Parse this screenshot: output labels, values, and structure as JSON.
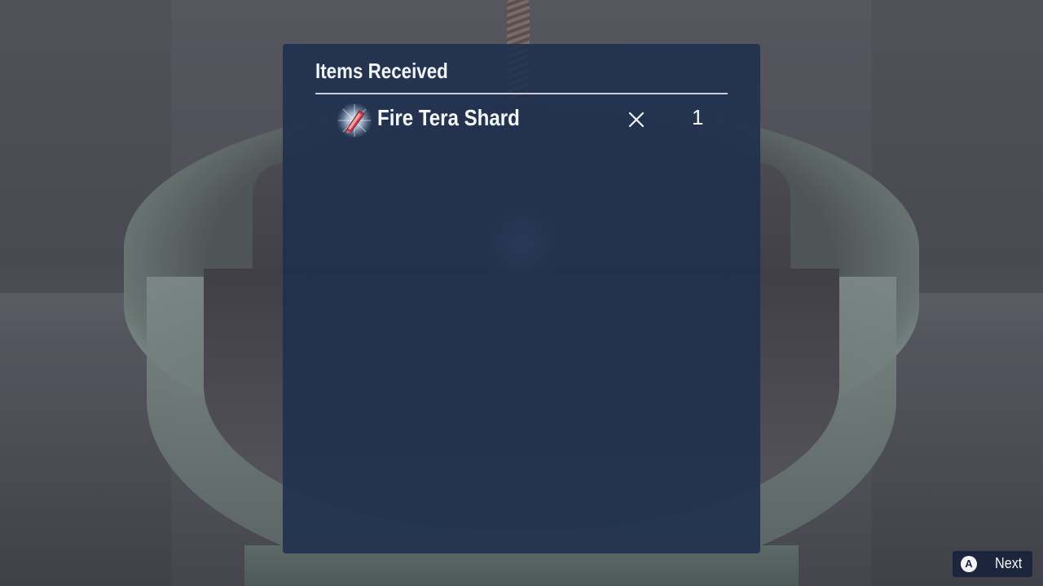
{
  "dialog": {
    "title": "Items Received",
    "items": [
      {
        "icon": "fire-tera-shard-icon",
        "name": "Fire Tera Shard",
        "times_symbol": "×",
        "quantity": "1"
      }
    ]
  },
  "prompt": {
    "button_glyph": "A",
    "label": "Next"
  },
  "colors": {
    "panel_bg": "#1e2f4e",
    "text": "#f5f6fa",
    "rule": "#c9ced8"
  }
}
